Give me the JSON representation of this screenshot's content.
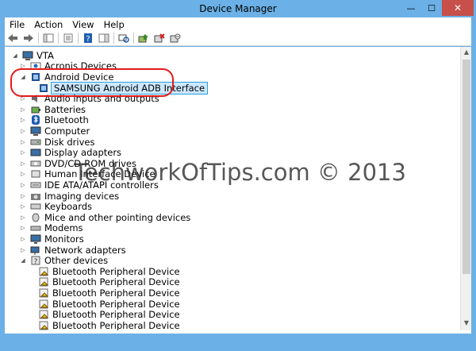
{
  "window": {
    "title": "Device Manager",
    "minimize": "—",
    "maximize": "☐",
    "close": "✕"
  },
  "menu": [
    "File",
    "Action",
    "View",
    "Help"
  ],
  "toolbar": [
    "back-arrow-icon",
    "forward-arrow-icon",
    "|",
    "show-hide-console-tree-icon",
    "|",
    "properties-icon",
    "|",
    "help-icon",
    "action-pane-icon",
    "|",
    "scan-hardware-icon",
    "|",
    "update-driver-icon",
    "uninstall-icon",
    "disable-device-icon"
  ],
  "tree": {
    "root": "VTA",
    "items": [
      {
        "label": "Acronis Devices",
        "expanded": false,
        "icon": "acronis"
      },
      {
        "label": "Android Device",
        "expanded": true,
        "icon": "android"
      },
      {
        "label": "SAMSUNG Android ADB Interface",
        "child": true,
        "selected": true,
        "icon": "adb"
      },
      {
        "label": "Audio inputs and outputs",
        "expanded": false,
        "icon": "audio"
      },
      {
        "label": "Batteries",
        "expanded": false,
        "icon": "battery"
      },
      {
        "label": "Bluetooth",
        "expanded": false,
        "icon": "bluetooth"
      },
      {
        "label": "Computer",
        "expanded": false,
        "icon": "computer"
      },
      {
        "label": "Disk drives",
        "expanded": false,
        "icon": "disk"
      },
      {
        "label": "Display adapters",
        "expanded": false,
        "icon": "display"
      },
      {
        "label": "DVD/CD-ROM drives",
        "expanded": false,
        "icon": "dvd"
      },
      {
        "label": "Human Interface Device",
        "expanded": false,
        "icon": "hid"
      },
      {
        "label": "IDE ATA/ATAPI controllers",
        "expanded": false,
        "icon": "ide"
      },
      {
        "label": "Imaging devices",
        "expanded": false,
        "icon": "camera"
      },
      {
        "label": "Keyboards",
        "expanded": false,
        "icon": "keyboard"
      },
      {
        "label": "Mice and other pointing devices",
        "expanded": false,
        "icon": "mouse"
      },
      {
        "label": "Modems",
        "expanded": false,
        "icon": "modem"
      },
      {
        "label": "Monitors",
        "expanded": false,
        "icon": "monitor"
      },
      {
        "label": "Network adapters",
        "expanded": false,
        "icon": "network"
      },
      {
        "label": "Other devices",
        "expanded": true,
        "icon": "other"
      },
      {
        "label": "Bluetooth Peripheral Device",
        "child": true,
        "icon": "unknown"
      },
      {
        "label": "Bluetooth Peripheral Device",
        "child": true,
        "icon": "unknown"
      },
      {
        "label": "Bluetooth Peripheral Device",
        "child": true,
        "icon": "unknown"
      },
      {
        "label": "Bluetooth Peripheral Device",
        "child": true,
        "icon": "unknown"
      },
      {
        "label": "Bluetooth Peripheral Device",
        "child": true,
        "icon": "unknown"
      },
      {
        "label": "Bluetooth Peripheral Device",
        "child": true,
        "icon": "unknown"
      }
    ]
  },
  "watermark": "TechworkOfTips.com © 2013",
  "colors": {
    "frame": "#6bb0e6",
    "close": "#c7504b",
    "selection": "#cce8ff",
    "highlight_ring": "#e31b1b"
  }
}
